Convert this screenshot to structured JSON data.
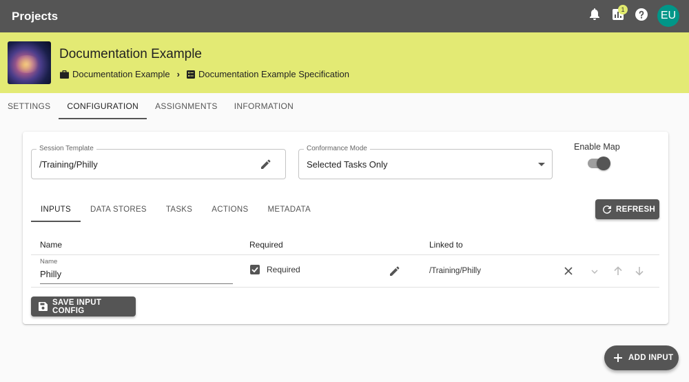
{
  "header": {
    "title": "Projects",
    "notification_badge": "1",
    "avatar_initials": "EU",
    "colors": {
      "bar": "#555555",
      "badge": "#e1ea6e",
      "avatar": "#009688"
    }
  },
  "project": {
    "title": "Documentation Example",
    "breadcrumb": [
      "Documentation Example",
      "Documentation Example Specification"
    ],
    "banner_color": "#e3ea74"
  },
  "main_tabs": [
    {
      "label": "SETTINGS"
    },
    {
      "label": "CONFIGURATION",
      "active": true
    },
    {
      "label": "ASSIGNMENTS"
    },
    {
      "label": "INFORMATION"
    }
  ],
  "config": {
    "session_template": {
      "label": "Session Template",
      "value": "/Training/Philly"
    },
    "conformance_mode": {
      "label": "Conformance Mode",
      "value": "Selected Tasks Only"
    },
    "enable_map": {
      "label": "Enable Map",
      "checked": true
    }
  },
  "sub_tabs": [
    {
      "label": "INPUTS",
      "active": true
    },
    {
      "label": "DATA STORES"
    },
    {
      "label": "TASKS"
    },
    {
      "label": "ACTIONS"
    },
    {
      "label": "METADATA"
    }
  ],
  "refresh_label": "REFRESH",
  "inputs_table": {
    "columns": [
      "Name",
      "Required",
      "Linked to"
    ],
    "rows": [
      {
        "name_label": "Name",
        "name": "Philly",
        "required_label": "Required",
        "required": true,
        "linked_to": "/Training/Philly"
      }
    ]
  },
  "save_label": "SAVE INPUT CONFIG",
  "add_input_label": "ADD INPUT"
}
